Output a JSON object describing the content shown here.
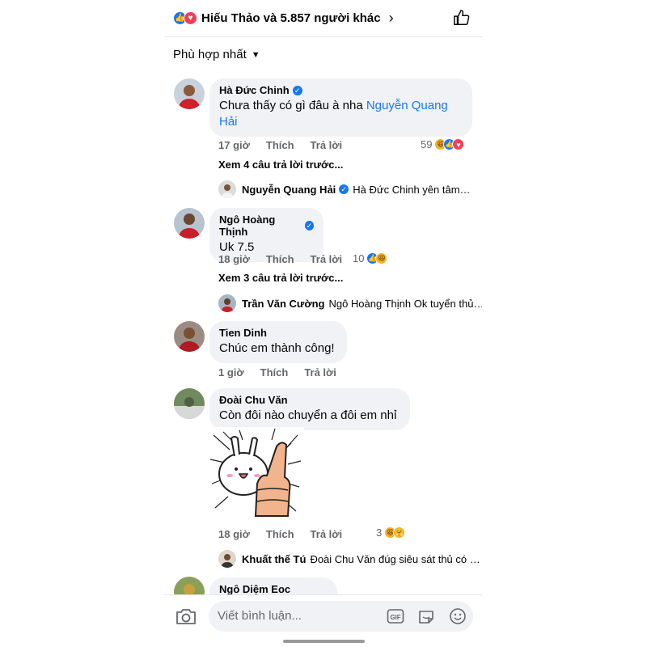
{
  "header": {
    "reactions_text": "Hiếu Thảo và 5.857 người khác",
    "chevron": "›"
  },
  "sort": {
    "label": "Phù hợp nhất"
  },
  "actions": {
    "like": "Thích",
    "reply": "Trả lời"
  },
  "comments": [
    {
      "name": "Hà Đức Chinh",
      "verified": true,
      "text": "Chưa thấy có gì đâu à nha ",
      "mention": "Nguyễn Quang Hải",
      "time": "17 giờ",
      "reaction_count": "59",
      "reactions": [
        "haha",
        "like",
        "love"
      ],
      "view_more": "Xem 4 câu trả lời trước...",
      "last_reply": {
        "name": "Nguyễn Quang Hải",
        "verified": true,
        "snippet": "Hà Đức Chinh  yên tâm…"
      }
    },
    {
      "name": "Ngô Hoàng Thịnh",
      "verified": true,
      "text": "Uk 7.5",
      "time": "18 giờ",
      "reaction_count": "10",
      "reactions": [
        "like",
        "haha"
      ],
      "view_more": "Xem 3 câu trả lời trước...",
      "last_reply": {
        "name": "Trần Văn Cường",
        "verified": false,
        "snippet": "Ngô Hoàng Thịnh Ok tuyển thủ…"
      }
    },
    {
      "name": "Tien Dinh",
      "verified": false,
      "text": "Chúc em thành công!",
      "time": "1 giờ"
    },
    {
      "name": "Đoài Chu Văn",
      "verified": false,
      "text": "Còn đôi nào chuyển a đôi em nhỉ",
      "time": "18 giờ",
      "reaction_count": "3",
      "reactions": [
        "haha",
        "care"
      ],
      "last_reply": {
        "name": "Khuất thế Tú",
        "verified": false,
        "snippet": "Đoài Chu Văn đúg siêu sát thủ có …"
      }
    },
    {
      "name": "Ngô Diệm Eoc",
      "verified": false
    }
  ],
  "composer": {
    "placeholder": "Viết bình luận...",
    "gif_label": "GIF"
  },
  "colors": {
    "accent": "#1877f2",
    "love": "#f33e58",
    "haha": "#f7b125",
    "bubble": "#f0f2f5",
    "meta": "#65676b"
  },
  "icons": [
    "like-reaction-icon",
    "love-reaction-icon",
    "haha-reaction-icon",
    "care-reaction-icon",
    "verified-badge-icon",
    "thumbs-up-icon",
    "camera-icon",
    "gif-icon",
    "sticker-icon",
    "emoji-icon",
    "chevron-right-icon",
    "chevron-down-icon"
  ]
}
